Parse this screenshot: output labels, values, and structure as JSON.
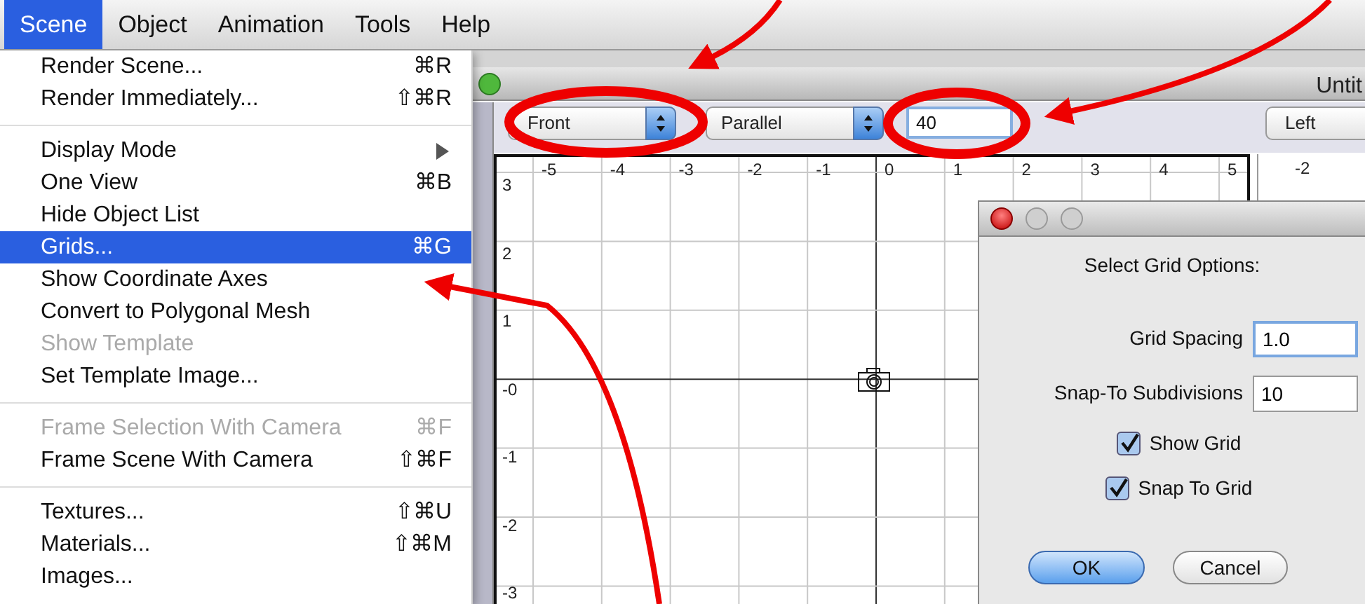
{
  "menu_bar": [
    {
      "label": "Scene",
      "selected": true
    },
    {
      "label": "Object",
      "selected": false
    },
    {
      "label": "Animation",
      "selected": false
    },
    {
      "label": "Tools",
      "selected": false
    },
    {
      "label": "Help",
      "selected": false
    }
  ],
  "menu": {
    "items": [
      {
        "kind": "item",
        "label": "Render Scene...",
        "shortcut": "⌘R",
        "disabled": false,
        "selected": false
      },
      {
        "kind": "item",
        "label": "Render Immediately...",
        "shortcut": "⇧⌘R",
        "disabled": false,
        "selected": false
      },
      {
        "kind": "separator"
      },
      {
        "kind": "item",
        "label": "Display Mode",
        "submenu": true,
        "disabled": false,
        "selected": false
      },
      {
        "kind": "item",
        "label": "One View",
        "shortcut": "⌘B",
        "disabled": false,
        "selected": false
      },
      {
        "kind": "item",
        "label": "Hide Object List",
        "disabled": false,
        "selected": false
      },
      {
        "kind": "item",
        "label": "Grids...",
        "shortcut": "⌘G",
        "disabled": false,
        "selected": true
      },
      {
        "kind": "item",
        "label": "Show Coordinate Axes",
        "disabled": false,
        "selected": false
      },
      {
        "kind": "item",
        "label": "Convert to Polygonal Mesh",
        "disabled": false,
        "selected": false
      },
      {
        "kind": "item",
        "label": "Show Template",
        "disabled": true,
        "selected": false
      },
      {
        "kind": "item",
        "label": "Set Template Image...",
        "disabled": false,
        "selected": false
      },
      {
        "kind": "separator"
      },
      {
        "kind": "item",
        "label": "Frame Selection With Camera",
        "shortcut": "⌘F",
        "disabled": true,
        "selected": false
      },
      {
        "kind": "item",
        "label": "Frame Scene With Camera",
        "shortcut": "⇧⌘F",
        "disabled": false,
        "selected": false
      },
      {
        "kind": "separator"
      },
      {
        "kind": "item",
        "label": "Textures...",
        "shortcut": "⇧⌘U",
        "disabled": false,
        "selected": false
      },
      {
        "kind": "item",
        "label": "Materials...",
        "shortcut": "⇧⌘M",
        "disabled": false,
        "selected": false
      },
      {
        "kind": "item",
        "label": "Images...",
        "disabled": false,
        "selected": false
      }
    ]
  },
  "window": {
    "title": "Untit"
  },
  "toolbar": {
    "view": "Front",
    "projection": "Parallel",
    "scale": "40",
    "view_2": "Left"
  },
  "viewport": {
    "x_labels": [
      "-5",
      "-4",
      "-3",
      "-2",
      "-1",
      "0",
      "1",
      "2",
      "3",
      "4",
      "5"
    ],
    "y_labels": [
      "3",
      "2",
      "1",
      "-0",
      "-1",
      "-2",
      "-3"
    ]
  },
  "viewport_2": {
    "x_labels": [
      "-2"
    ]
  },
  "dialog": {
    "heading": "Select Grid Options:",
    "fields": [
      {
        "label": "Grid Spacing",
        "value": "1.0",
        "focused": true
      },
      {
        "label": "Snap-To Subdivisions",
        "value": "10",
        "focused": false
      }
    ],
    "checkboxes": [
      {
        "label": "Show Grid",
        "checked": true
      },
      {
        "label": "Snap To Grid",
        "checked": true
      }
    ],
    "buttons": [
      {
        "label": "OK",
        "default": true
      },
      {
        "label": "Cancel",
        "default": false
      }
    ]
  }
}
